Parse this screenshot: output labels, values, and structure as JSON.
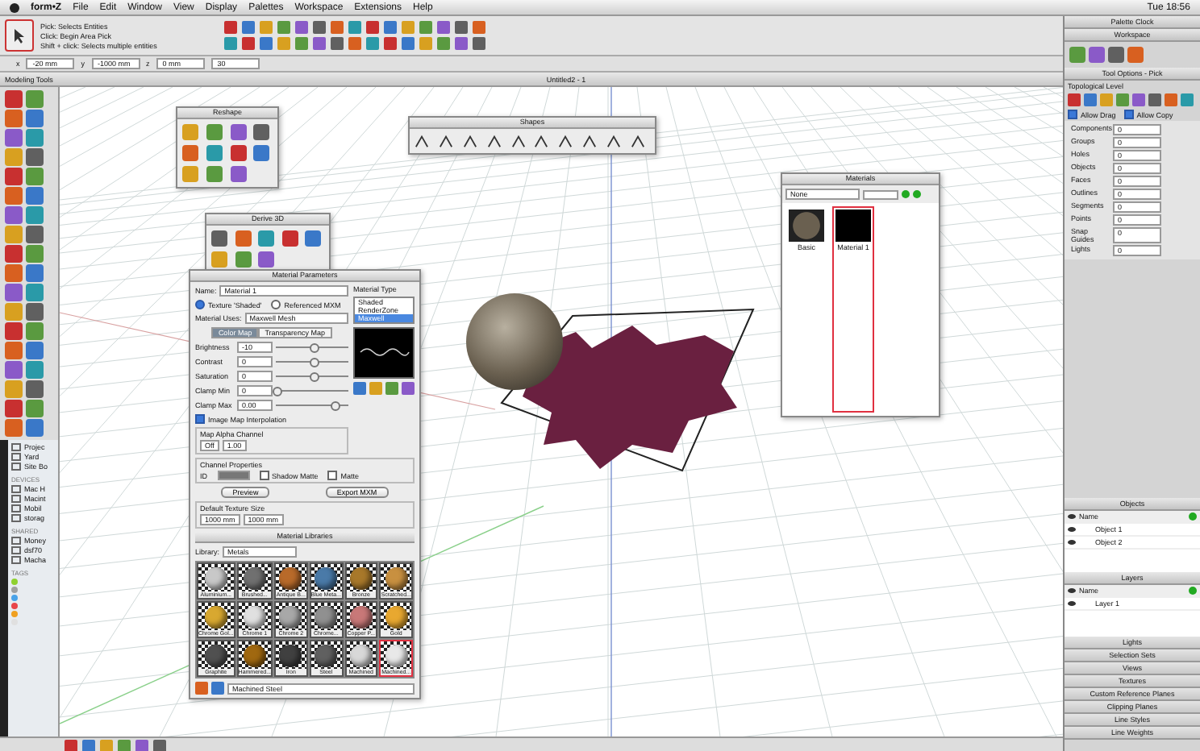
{
  "menu_bar": {
    "items": [
      "form•Z",
      "File",
      "Edit",
      "Window",
      "View",
      "Display",
      "Palettes",
      "Workspace",
      "Extensions",
      "Help"
    ],
    "clock": "Tue 18:56"
  },
  "tool_options": {
    "title": "Pick: Selects Entities",
    "hints": [
      "Click: Begin Area Pick",
      "Shift + click: Selects multiple entities"
    ]
  },
  "coordinates": [
    {
      "axis": "x",
      "value": "-20 mm"
    },
    {
      "axis": "y",
      "value": "-1000 mm"
    },
    {
      "axis": "z",
      "value": "0 mm"
    },
    {
      "value": "30"
    }
  ],
  "tool_panel": {
    "title": "Modeling Tools"
  },
  "viewport": {
    "title": "Untitled2 - 1"
  },
  "finder_sidebar": {
    "items": [
      {
        "label": "Projec"
      },
      {
        "label": "Yard"
      },
      {
        "label": "Site Bo"
      }
    ],
    "devices_heading": "DEVICES",
    "devices": [
      {
        "label": "Mac H"
      },
      {
        "label": "Macint"
      },
      {
        "label": "Mobil"
      },
      {
        "label": "storag"
      }
    ],
    "shared_heading": "SHARED",
    "shared": [
      {
        "label": "Money"
      },
      {
        "label": "dsf70"
      },
      {
        "label": "Macha"
      }
    ],
    "tags_heading": "TAGS",
    "tags": [
      {
        "color": "#8fd12f"
      },
      {
        "color": "#a0a0a0"
      },
      {
        "color": "#4aa3e8"
      },
      {
        "color": "#e8454a"
      },
      {
        "color": "#f0a020"
      },
      {
        "color": "#e0e0e0"
      }
    ]
  },
  "reshape_palette": {
    "title": "Reshape"
  },
  "shapes_palette": {
    "title": "Shapes"
  },
  "derive_palette": {
    "title": "Derive 3D"
  },
  "material_parameters": {
    "title": "Material Parameters",
    "name_label": "Name:",
    "name": "Material 1",
    "sources": [
      {
        "label": "Texture 'Shaded'",
        "selected": true
      },
      {
        "label": "Referenced MXM",
        "selected": false
      }
    ],
    "type_heading": "Material Type",
    "types": [
      {
        "label": "Shaded",
        "selected": false
      },
      {
        "label": "RenderZone",
        "selected": false
      },
      {
        "label": "Maxwell",
        "selected": true
      }
    ],
    "uses_label": "Material Uses:",
    "uses": "Maxwell Mesh",
    "tabs": [
      {
        "label": "Color Map",
        "selected": true
      },
      {
        "label": "Transparency Map",
        "selected": false
      }
    ],
    "sliders": [
      {
        "label": "Brightness",
        "value": "-10",
        "level": 0.5
      },
      {
        "label": "Contrast",
        "value": "0",
        "level": 0.5
      },
      {
        "label": "Saturation",
        "value": "0",
        "level": 0.5
      },
      {
        "label": "Clamp Min",
        "value": "0",
        "level": 0
      },
      {
        "label": "Clamp Max",
        "value": "0.00",
        "level": 0.8
      }
    ],
    "interpolation": {
      "label": "Image Map Interpolation",
      "checked": true
    },
    "alpha_label": "Map Alpha Channel",
    "alpha_mode": "Off",
    "alpha_value": "1.00",
    "channel_heading": "Channel Properties",
    "channel_id": "ID",
    "channel_options": [
      {
        "label": "Shadow Matte",
        "checked": false
      },
      {
        "label": "Matte",
        "checked": false
      }
    ],
    "buttons": [
      "Preview",
      "Export MXM"
    ],
    "size_heading": "Default Texture Size",
    "size_x": "1000 mm",
    "size_y": "1000 mm"
  },
  "material_library": {
    "title": "Material Libraries",
    "library_label": "Library:",
    "library": "Metals",
    "swatches": [
      {
        "label": "Aluminium...",
        "color": "#c8c8c8",
        "selected": false
      },
      {
        "label": "Brushed...",
        "color": "#707070",
        "selected": false
      },
      {
        "label": "Antique B...",
        "color": "#b86a2a",
        "selected": false
      },
      {
        "label": "Blue Meta...",
        "color": "#4a7aa8",
        "selected": false
      },
      {
        "label": "Bronze",
        "color": "#a8782a",
        "selected": false
      },
      {
        "label": "Scratched...",
        "color": "#c89040",
        "selected": false
      },
      {
        "label": "Chrome Gol...",
        "color": "#d8a830",
        "selected": false
      },
      {
        "label": "Chrome 1",
        "color": "#e0e0e0",
        "selected": false
      },
      {
        "label": "Chrome 2",
        "color": "#a8a8a8",
        "selected": false
      },
      {
        "label": "Chrome...",
        "color": "#909090",
        "selected": false
      },
      {
        "label": "Copper P...",
        "color": "#c87878",
        "selected": false
      },
      {
        "label": "Gold",
        "color": "#e8a830",
        "selected": false
      },
      {
        "label": "Graphite",
        "color": "#505050",
        "selected": false
      },
      {
        "label": "Hammered...",
        "color": "#a06810",
        "selected": false
      },
      {
        "label": "Iron",
        "color": "#404040",
        "selected": false
      },
      {
        "label": "Steel",
        "color": "#606060",
        "selected": false
      },
      {
        "label": "Machined",
        "color": "#d8d8d8",
        "selected": false
      },
      {
        "label": "Machined...",
        "color": "#e8e8e8",
        "selected": true
      }
    ],
    "current": "Machined Steel"
  },
  "materials_window": {
    "title": "Materials",
    "filter": "None",
    "items": [
      {
        "label": "Basic",
        "kind": "sphere",
        "selected": false
      },
      {
        "label": "Material 1",
        "kind": "preview",
        "selected": true
      }
    ]
  },
  "right_panel": {
    "clock_title": "Palette Clock",
    "workspace_title": "Workspace",
    "options_title": "Tool Options - Pick",
    "level_heading": "Topological Level",
    "checks": [
      {
        "label": "Allow Drag",
        "checked": true
      },
      {
        "label": "Allow Copy",
        "checked": true
      }
    ],
    "stats": [
      {
        "label": "Components",
        "value": "0"
      },
      {
        "label": "Groups",
        "value": "0"
      },
      {
        "label": "Holes",
        "value": "0"
      },
      {
        "label": "Objects",
        "value": "0"
      },
      {
        "label": "Faces",
        "value": "0"
      },
      {
        "label": "Outlines",
        "value": "0"
      },
      {
        "label": "Segments",
        "value": "0"
      },
      {
        "label": "Points",
        "value": "0"
      },
      {
        "label": "Snap Guides",
        "value": "0"
      },
      {
        "label": "Lights",
        "value": "0"
      }
    ],
    "objects": {
      "title": "Objects",
      "column": "Name",
      "rows": [
        "Object 1",
        "Object 2"
      ]
    },
    "layers": {
      "title": "Layers",
      "column": "Name",
      "rows": [
        "Layer 1"
      ]
    },
    "sections": [
      "Lights",
      "Selection Sets",
      "Views",
      "Textures",
      "Custom Reference Planes",
      "Clipping Planes",
      "Line Styles",
      "Line Weights"
    ]
  }
}
